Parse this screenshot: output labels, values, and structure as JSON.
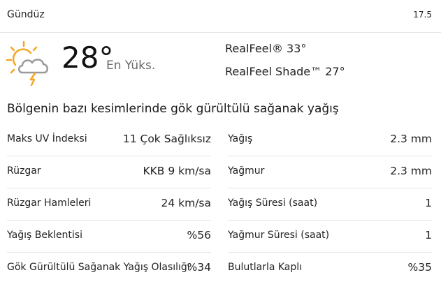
{
  "header": {
    "title": "Gündüz",
    "date": "17.5"
  },
  "current": {
    "icon": "sun-cloud-lightning-icon",
    "temperature": "28°",
    "temp_label": "En Yüks.",
    "realfeel": "RealFeel® 33°",
    "realfeel_shade": "RealFeel Shade™ 27°"
  },
  "phrase": "Bölgenin bazı kesimlerinde gök gürültülü sağanak yağış",
  "details_left": [
    {
      "label": "Maks UV İndeksi",
      "value": "11 Çok Sağlıksız"
    },
    {
      "label": "Rüzgar",
      "value": "KKB 9 km/sa"
    },
    {
      "label": "Rüzgar Hamleleri",
      "value": "24 km/sa"
    },
    {
      "label": "Yağış Beklentisi",
      "value": "%56"
    },
    {
      "label": "Gök Gürültülü Sağanak Yağış Olasılığı",
      "value": "%34"
    }
  ],
  "details_right": [
    {
      "label": "Yağış",
      "value": "2.3 mm"
    },
    {
      "label": "Yağmur",
      "value": "2.3 mm"
    },
    {
      "label": "Yağış Süresi (saat)",
      "value": "1"
    },
    {
      "label": "Yağmur Süresi (saat)",
      "value": "1"
    },
    {
      "label": "Bulutlarla Kaplı",
      "value": "%35"
    }
  ],
  "colors": {
    "sun": "#f5a623",
    "cloud": "#9a9a9a",
    "divider": "#e3e3e3"
  }
}
